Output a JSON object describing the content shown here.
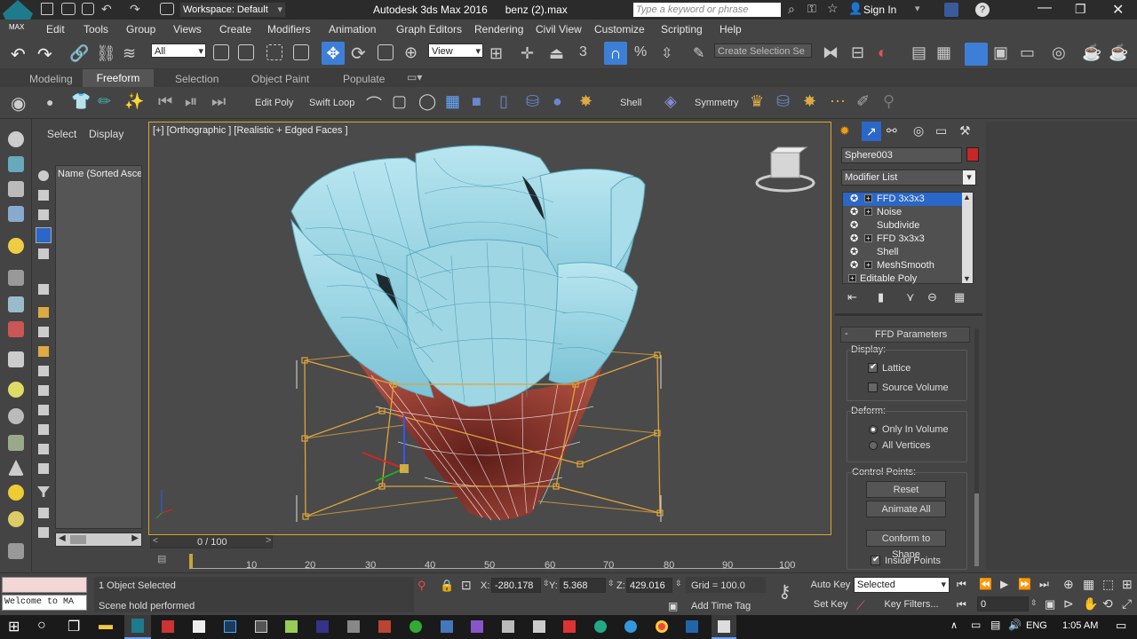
{
  "title_bar": {
    "workspace": "Workspace: Default",
    "title": "Autodesk 3ds Max 2016      benz (2).max",
    "search_placeholder": "Type a keyword or phrase",
    "sign_in": "Sign In",
    "app_logo": "MAX"
  },
  "menu": [
    "Edit",
    "Tools",
    "Group",
    "Views",
    "Create",
    "Modifiers",
    "Animation",
    "Graph Editors",
    "Rendering",
    "Civil View",
    "Customize",
    "Scripting",
    "Help"
  ],
  "toolbar": {
    "filter": "All",
    "ref_coord": "View",
    "selection_set_placeholder": "Create Selection Se"
  },
  "ribbon_tabs": [
    "Modeling",
    "Freeform",
    "Selection",
    "Object Paint",
    "Populate"
  ],
  "ribbon": {
    "edit_poly": "Edit Poly",
    "swift_loop": "Swift Loop",
    "shell": "Shell",
    "symmetry": "Symmetry"
  },
  "scene_explorer": {
    "tab_select": "Select",
    "tab_display": "Display",
    "column_header": "Name (Sorted Ascen"
  },
  "viewport": {
    "label": "[+] [Orthographic ] [Realistic + Edged Faces ]"
  },
  "command_panel": {
    "object_name": "Sphere003",
    "modifier_list": "Modifier List",
    "stack": [
      "FFD 3x3x3",
      "Noise",
      "Subdivide",
      "FFD 3x3x3",
      "Shell",
      "MeshSmooth",
      "Editable Poly"
    ],
    "rollout_title": "FFD Parameters",
    "display_label": "Display:",
    "lattice": "Lattice",
    "source_volume": "Source Volume",
    "deform_label": "Deform:",
    "only_in_volume": "Only In Volume",
    "all_vertices": "All Vertices",
    "control_points_label": "Control Points:",
    "reset": "Reset",
    "animate_all": "Animate All",
    "conform_to_shape": "Conform to Shape",
    "inside_points": "Inside Points",
    "lattice_checked": true,
    "source_volume_checked": false,
    "inside_points_checked": true
  },
  "timeline": {
    "frame_counter": "0 / 100",
    "ticks": [
      "10",
      "20",
      "30",
      "40",
      "50",
      "60",
      "70",
      "80",
      "90",
      "100"
    ]
  },
  "status": {
    "selection": "1 Object Selected",
    "prompt": "Scene hold performed",
    "maxscript": "Welcome to MA",
    "x_label": "X:",
    "x_value": "-280.178",
    "y_label": "Y:",
    "y_value": "5.368",
    "z_label": "Z:",
    "z_value": "429.016",
    "grid": "Grid = 100.0",
    "add_time_tag": "Add Time Tag",
    "auto_key": "Auto Key",
    "set_key": "Set Key",
    "key_mode": "Selected",
    "key_filters": "Key Filters...",
    "current_frame": "0"
  },
  "taskbar": {
    "language": "ENG",
    "time": "1:05 AM"
  },
  "colors": {
    "accent_blue": "#2a67c8",
    "viewport_border": "#d8a82b",
    "lattice_orange": "#e0a43a",
    "petal_blue": "#9fd6e3",
    "core_red": "#9b3a2e",
    "object_color": "#c62828"
  }
}
